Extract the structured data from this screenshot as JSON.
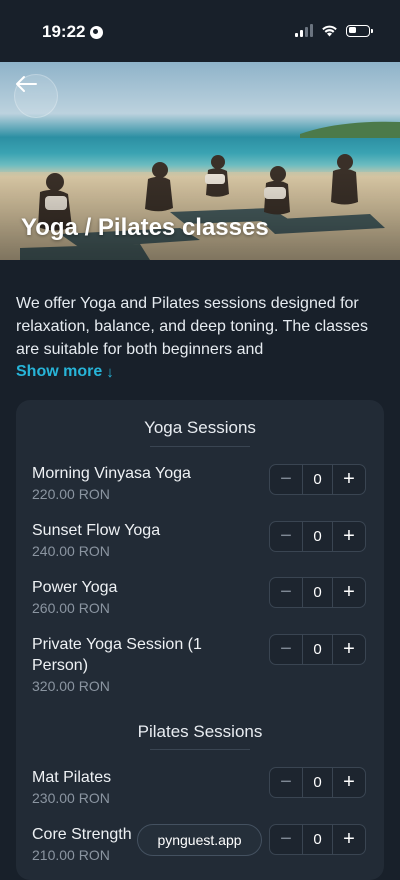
{
  "status_bar": {
    "time": "19:22"
  },
  "hero": {
    "title": "Yoga / Pilates classes"
  },
  "description": {
    "text": "We offer Yoga and Pilates sessions designed for relaxation, balance, and deep toning. The classes are suitable for both beginners and",
    "show_more": "Show more",
    "show_more_arrow": "↓"
  },
  "sections": [
    {
      "title": "Yoga Sessions",
      "items": [
        {
          "name": "Morning Vinyasa Yoga",
          "price": "220.00 RON",
          "qty": "0"
        },
        {
          "name": "Sunset Flow Yoga",
          "price": "240.00 RON",
          "qty": "0"
        },
        {
          "name": "Power Yoga",
          "price": "260.00 RON",
          "qty": "0"
        },
        {
          "name": "Private Yoga Session (1 Person)",
          "price": "320.00 RON",
          "qty": "0"
        }
      ]
    },
    {
      "title": "Pilates Sessions",
      "items": [
        {
          "name": "Mat Pilates",
          "price": "230.00 RON",
          "qty": "0"
        },
        {
          "name": "Core Strength",
          "price": "210.00 RON",
          "qty": "0"
        }
      ]
    }
  ],
  "stepper": {
    "minus": "−",
    "plus": "+"
  },
  "watermark": {
    "text": "pynguest.app"
  }
}
